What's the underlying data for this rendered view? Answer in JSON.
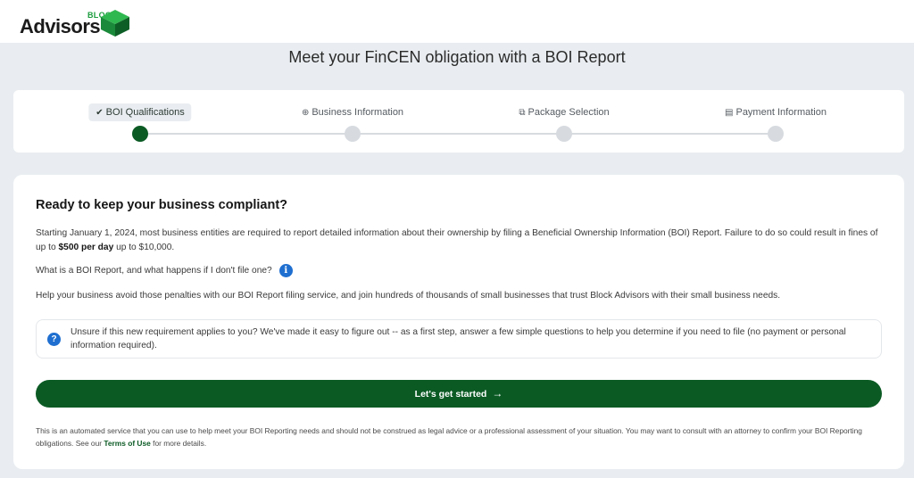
{
  "brand": {
    "block_word": "BLOCK",
    "advisors_word": "Advisors",
    "icon": "green-cube-logo",
    "green": "#0b5a24"
  },
  "page_title": "Meet your FinCEN obligation with a BOI Report",
  "steps": [
    {
      "label": "BOI Qualifications",
      "icon": "check-icon",
      "glyph": "✔",
      "active": true
    },
    {
      "label": "Business Information",
      "icon": "globe-icon",
      "glyph": "🌐",
      "active": false
    },
    {
      "label": "Package Selection",
      "icon": "package-icon",
      "glyph": "⧉",
      "active": false
    },
    {
      "label": "Payment Information",
      "icon": "card-icon",
      "glyph": "▤",
      "active": false
    }
  ],
  "main": {
    "heading": "Ready to keep your business compliant?",
    "intro_before": "Starting January 1, 2024, most business entities are required to report detailed information about their ownership by filing a Beneficial Ownership Information (BOI) Report. Failure to do so could result in fines of up to ",
    "intro_bold": "$500 per day",
    "intro_after": " up to $10,000.",
    "what_is_link": "What is a BOI Report, and what happens if I don't file one?",
    "help_text": "Help your business avoid those penalties with our BOI Report filing service, and join hundreds of thousands of small businesses that trust Block Advisors with their small business needs.",
    "notice_text": "Unsure if this new requirement applies to you? We've made it easy to figure out -- as a first step, answer a few simple questions to help you determine if you need to file (no payment or personal information required).",
    "cta_label": "Let's get started",
    "disclaimer_before": "This is an automated service that you can use to help meet your BOI Reporting needs and should not be construed as legal advice or a professional assessment of your situation. You may want to consult with an attorney to confirm your BOI Reporting obligations. See our ",
    "terms_link": "Terms of Use",
    "disclaimer_after": " for more details."
  }
}
